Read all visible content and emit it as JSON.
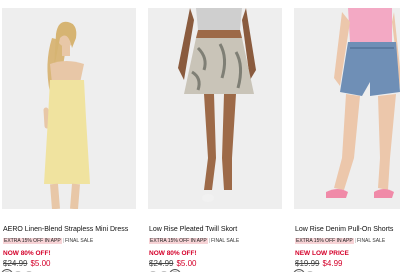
{
  "products": [
    {
      "name": "AERO Linen-Blend Strapless Mini Dress",
      "promo": "EXTRA 15% OFF IN APP",
      "final": "FINAL SALE",
      "flag": "NOW 80% OFF!",
      "was_price": "$24.99",
      "price": "$5.00",
      "swatches": [
        "#efe29a",
        "#f7f5ee",
        "#a9c2e2"
      ],
      "photo_desc": "model in yellow strapless mini dress"
    },
    {
      "name": "Low Rise Pleated Twill Skort",
      "promo": "EXTRA 15% OFF IN APP",
      "final": "FINAL SALE",
      "flag": "NOW 80% OFF!",
      "was_price": "$24.99",
      "price": "$5.00",
      "swatches": [
        "#3b3b3b",
        "#d8c3a5",
        "#6b6b55"
      ],
      "photo_desc": "model in floral pleated skort"
    },
    {
      "name": "Low Rise Denim Pull-On Shorts",
      "promo": "EXTRA 15% OFF IN APP",
      "final": "FINAL SALE",
      "flag": "NEW LOW PRICE",
      "was_price": "$19.99",
      "price": "$4.99",
      "swatches": [
        "#7b98b8",
        "#dfe9f2"
      ],
      "photo_desc": "model in blue denim pull-on shorts"
    }
  ],
  "colors": {
    "sale_red": "#d4002a",
    "promo_pink": "#f7d3d6",
    "photo_bg": "#eeeeee"
  }
}
